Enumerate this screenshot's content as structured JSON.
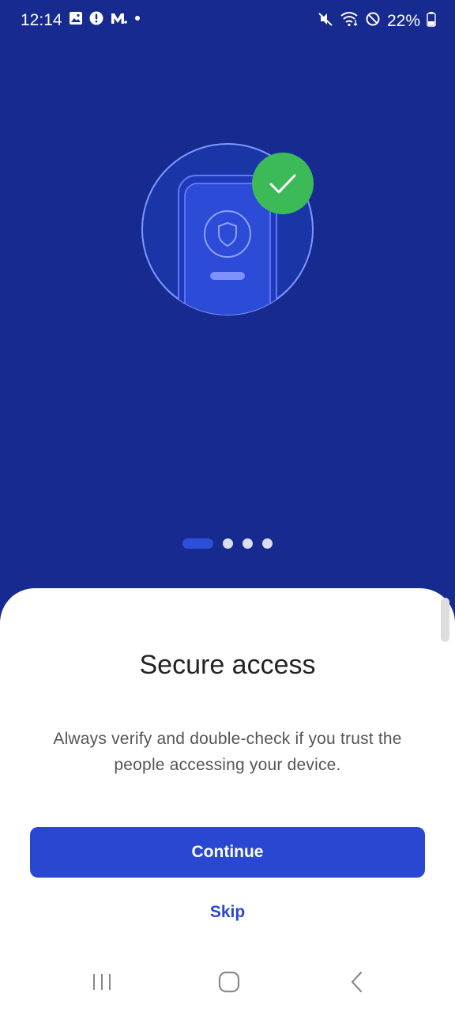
{
  "status_bar": {
    "time": "12:14",
    "battery": "22%",
    "left_icons": [
      "gallery-icon",
      "alert-icon",
      "app-m-icon",
      "dot-icon"
    ],
    "right_icons": [
      "mute-icon",
      "wifi-icon",
      "block-icon",
      "battery-icon"
    ]
  },
  "onboarding": {
    "pager": {
      "pages": 4,
      "active": 1
    },
    "title": "Secure access",
    "description": "Always verify and double-check if you trust the people accessing your device.",
    "continue_label": "Continue",
    "skip_label": "Skip"
  },
  "nav_bar": {
    "buttons": [
      "recents-icon",
      "home-icon",
      "back-icon"
    ]
  },
  "colors": {
    "background": "#162a8f",
    "accent": "#2947d0",
    "success": "#3dba58",
    "sheet": "#ffffff"
  }
}
